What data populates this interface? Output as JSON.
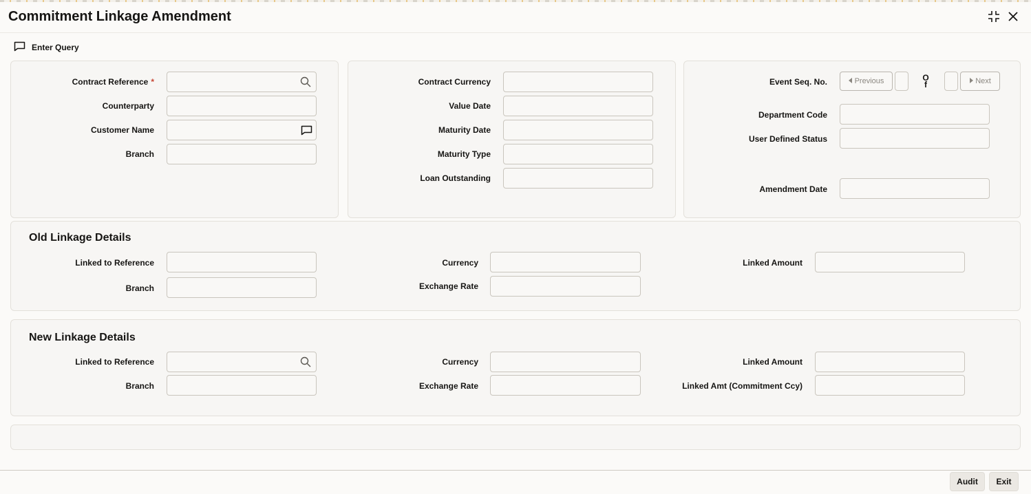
{
  "window": {
    "title": "Commitment Linkage Amendment"
  },
  "toolbar": {
    "enter_query": "Enter Query"
  },
  "contract": {
    "contract_reference": "Contract Reference",
    "required_mark": "*",
    "counterparty": "Counterparty",
    "customer_name": "Customer Name",
    "branch": "Branch"
  },
  "details": {
    "contract_currency": "Contract Currency",
    "value_date": "Value Date",
    "maturity_date": "Maturity Date",
    "maturity_type": "Maturity Type",
    "loan_outstanding": "Loan Outstanding"
  },
  "event": {
    "event_seq_no": "Event Seq. No.",
    "previous": "Previous",
    "of": "O\nf",
    "next": "Next",
    "department_code": "Department Code",
    "user_defined_status": "User Defined Status",
    "amendment_date": "Amendment Date"
  },
  "old_linkage": {
    "title": "Old Linkage Details",
    "linked_to_reference": "Linked to Reference",
    "branch": "Branch",
    "currency": "Currency",
    "exchange_rate": "Exchange Rate",
    "linked_amount": "Linked Amount"
  },
  "new_linkage": {
    "title": "New Linkage Details",
    "linked_to_reference": "Linked to Reference",
    "branch": "Branch",
    "currency": "Currency",
    "exchange_rate": "Exchange Rate",
    "linked_amount": "Linked Amount",
    "linked_amt_commitment_ccy": "Linked Amt (Commitment Ccy)"
  },
  "footer": {
    "audit": "Audit",
    "exit": "Exit"
  },
  "colors": {
    "required": "#c74634",
    "panel_bg": "#f7f6f4",
    "page_bg": "#fbfaf8"
  },
  "icons": [
    "maximize-icon",
    "close-icon",
    "comment-icon",
    "search-icon",
    "chevron-left-icon",
    "chevron-right-icon"
  ]
}
